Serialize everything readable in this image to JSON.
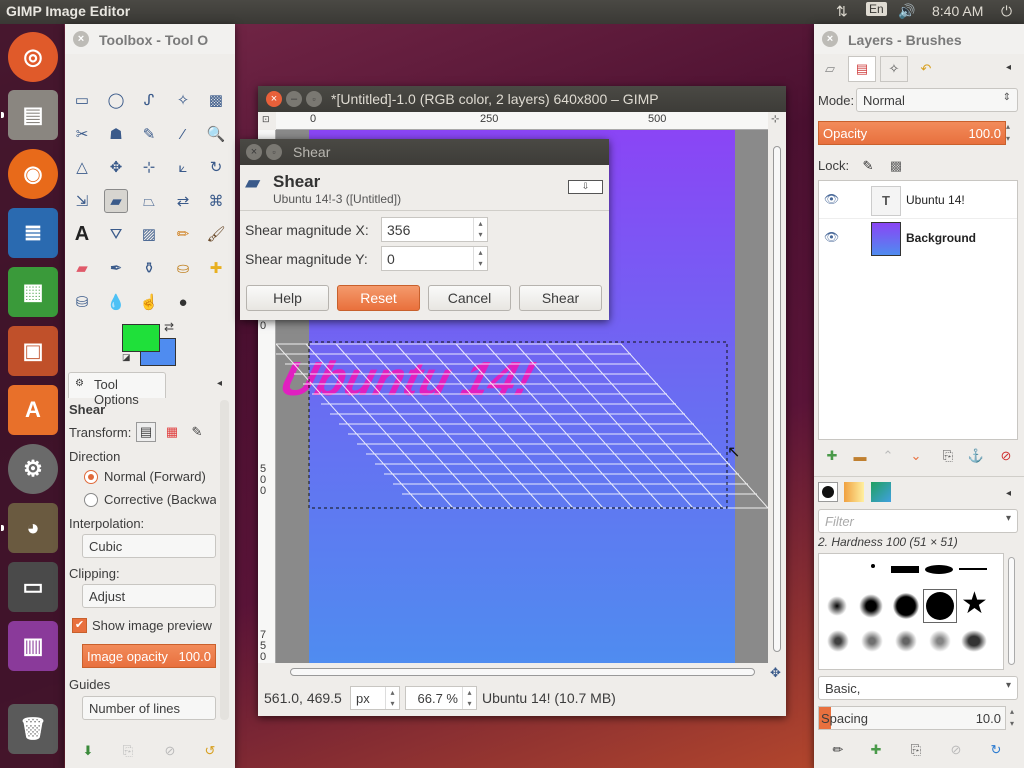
{
  "topbar": {
    "app_title": "GIMP Image Editor",
    "lang": "En",
    "clock": "8:40 AM"
  },
  "launcher": {
    "items": [
      "ubuntu-home",
      "files",
      "firefox",
      "writer",
      "calc",
      "impress",
      "software-center",
      "system-settings",
      "gimp",
      "drive",
      "workspace",
      "trash"
    ]
  },
  "toolbox": {
    "title": "Toolbox - Tool O",
    "tool_options_tab": "Tool Options",
    "tool_name": "Shear",
    "transform_label": "Transform:",
    "direction_label": "Direction",
    "direction_normal": "Normal (Forward)",
    "direction_corrective": "Corrective (Backwar",
    "interpolation_label": "Interpolation:",
    "interpolation_value": "Cubic",
    "clipping_label": "Clipping:",
    "clipping_value": "Adjust",
    "show_preview_label": "Show image preview",
    "image_opacity_label": "Image opacity",
    "image_opacity_value": "100.0",
    "guides_label": "Guides",
    "guides_value": "Number of lines"
  },
  "colors": {
    "fg": "#1fe03a",
    "bg": "#4f8cf0"
  },
  "image_window": {
    "title": "*[Untitled]-1.0 (RGB color, 2 layers) 640x800 – GIMP",
    "ruler_0": "0",
    "ruler_250": "250",
    "ruler_500": "500",
    "vruler_0": "0",
    "vruler_500": "500",
    "vruler_750": "750",
    "coords": "561.0, 469.5",
    "unit": "px",
    "zoom": "66.7 %",
    "status": "Ubuntu 14! (10.7 MB)",
    "canvas_text": "Ubuntu 14!"
  },
  "shear_dialog": {
    "title": "Shear",
    "heading": "Shear",
    "subtitle": "Ubuntu 14!-3 ([Untitled])",
    "x_label": "Shear magnitude X:",
    "x_value": "356",
    "y_label": "Shear magnitude Y:",
    "y_value": "0",
    "help": "Help",
    "reset": "Reset",
    "cancel": "Cancel",
    "shear": "Shear"
  },
  "layers": {
    "title": "Layers - Brushes",
    "mode_label": "Mode:",
    "mode_value": "Normal",
    "opacity_label": "Opacity",
    "opacity_value": "100.0",
    "lock_label": "Lock:",
    "items": [
      {
        "name": "Ubuntu 14!"
      },
      {
        "name": "Background"
      }
    ]
  },
  "brushes": {
    "filter_placeholder": "Filter",
    "brush_name": "2. Hardness 100 (51 × 51)",
    "preset": "Basic,",
    "spacing_label": "Spacing",
    "spacing_value": "10.0"
  }
}
